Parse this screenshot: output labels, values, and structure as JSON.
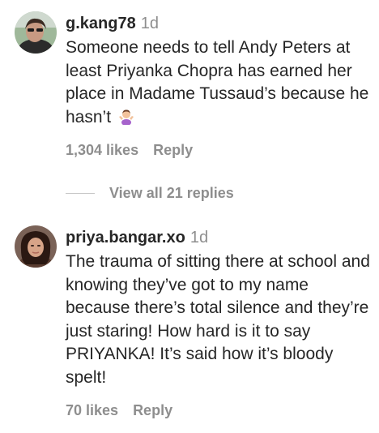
{
  "comments": [
    {
      "username": "g.kang78",
      "time": "1d",
      "text": "Someone needs to tell Andy Peters at least Priyanka Chopra has earned her place in Madame Tussaud’s because he hasn’t",
      "emoji": "woman-shrugging-emoji",
      "likes": "1,304 likes",
      "reply_label": "Reply",
      "view_replies": "View all 21 replies"
    },
    {
      "username": "priya.bangar.xo",
      "time": "1d",
      "text": "The trauma of sitting there at school and knowing they’ve got to my name because there’s total silence and they’re just staring! How hard is it to say PRIYANKA! It’s said how it’s bloody spelt!",
      "likes": "70 likes",
      "reply_label": "Reply"
    }
  ],
  "colors": {
    "primary_text": "#262626",
    "secondary_text": "#8e8e8e",
    "divider": "#c7c7c7"
  }
}
